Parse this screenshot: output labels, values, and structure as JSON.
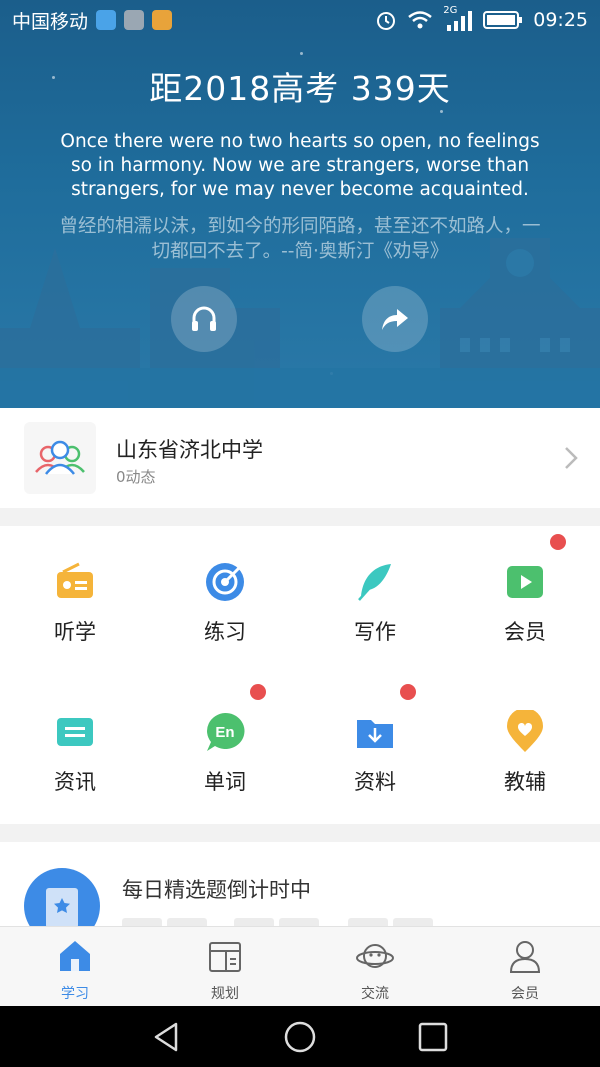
{
  "status_bar": {
    "carrier": "中国移动",
    "network": "2G",
    "time": "09:25",
    "icons": [
      "health-app-icon",
      "gallery-app-icon",
      "weibo-app-icon",
      "alarm-icon",
      "wifi-icon",
      "signal-icon",
      "battery-icon"
    ]
  },
  "hero": {
    "countdown": "距2018高考 339天",
    "quote_en": "Once there were no two hearts so open, no feelings so in harmony. Now we are strangers, worse than strangers, for we may never become acquainted.",
    "quote_cn": "曾经的相濡以沫，到如今的形同陌路，甚至还不如路人，一切都回不去了。--简·奥斯汀《劝导》",
    "buttons": [
      "headphones-icon",
      "share-icon"
    ]
  },
  "school": {
    "name": "山东省济北中学",
    "activity": "0动态"
  },
  "features": [
    {
      "label": "听学",
      "icon": "radio-icon",
      "color": "#f5b43a",
      "badge": false
    },
    {
      "label": "练习",
      "icon": "target-icon",
      "color": "#3d8be6",
      "badge": false
    },
    {
      "label": "写作",
      "icon": "feather-icon",
      "color": "#3cc8c0",
      "badge": false
    },
    {
      "label": "会员",
      "icon": "video-icon",
      "color": "#4cc06e",
      "badge": true
    },
    {
      "label": "资讯",
      "icon": "news-icon",
      "color": "#3cc8c0",
      "badge": false
    },
    {
      "label": "单词",
      "icon": "word-bubble-icon",
      "color": "#4cc06e",
      "badge": true
    },
    {
      "label": "资料",
      "icon": "folder-download-icon",
      "color": "#3d8be6",
      "badge": true
    },
    {
      "label": "教辅",
      "icon": "heart-pin-icon",
      "color": "#f5b43a",
      "badge": false
    }
  ],
  "daily": {
    "title": "每日精选题倒计时中"
  },
  "tabs": [
    {
      "label": "学习",
      "icon": "home-icon",
      "active": true
    },
    {
      "label": "规划",
      "icon": "plan-icon",
      "active": false
    },
    {
      "label": "交流",
      "icon": "planet-icon",
      "active": false
    },
    {
      "label": "会员",
      "icon": "user-icon",
      "active": false
    }
  ],
  "colors": {
    "accent": "#3d8be6",
    "badge": "#e84f4f",
    "hero": "#1f6d9c"
  }
}
